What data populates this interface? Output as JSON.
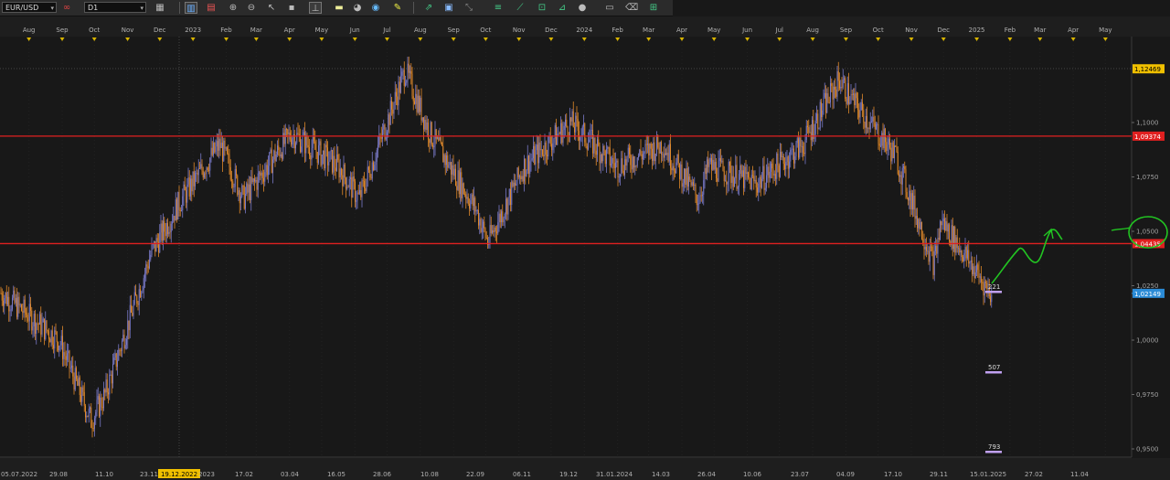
{
  "toolbar": {
    "symbol": "EUR/USD",
    "timeframe": "D1",
    "icons": [
      "chart-type-icon",
      "candles-icon",
      "bars-icon",
      "line-icon",
      "zoom-in-icon",
      "zoom-out-icon",
      "cursor-icon",
      "crosshair-icon",
      "period-separator-icon",
      "text-icon",
      "folder-icon",
      "globe-icon",
      "pencil-icon",
      "trend-icon",
      "indicator-icon",
      "fibonacci-icon",
      "ray-icon",
      "channel-icon",
      "rect-icon",
      "ellipse-icon",
      "settings-icon",
      "eraser-icon",
      "ruler-icon"
    ]
  },
  "top_axis_months": [
    "Aug",
    "Sep",
    "Oct",
    "Nov",
    "Dec",
    "2023",
    "Feb",
    "Mar",
    "Apr",
    "May",
    "Jun",
    "Jul",
    "Aug",
    "Sep",
    "Oct",
    "Nov",
    "Dec",
    "2024",
    "Feb",
    "Mar",
    "Apr",
    "May",
    "Jun",
    "Jul",
    "Aug",
    "Sep",
    "Oct",
    "Nov",
    "Dec",
    "2025",
    "Feb",
    "Mar",
    "Apr",
    "May"
  ],
  "bottom_axis_labels": [
    "05.07.2022",
    "29.08",
    "11.10",
    "23.11",
    "19.12.2022",
    "2023",
    "17.02",
    "03.04",
    "16.05",
    "28.06",
    "10.08",
    "22.09",
    "06.11",
    "19.12",
    "31.01.2024",
    "14.03",
    "26.04",
    "10.06",
    "23.07",
    "04.09",
    "17.10",
    "29.11",
    "15.01.2025",
    "27.02",
    "11.04"
  ],
  "highlighted_date": "19.12.2022",
  "price_axis_ticks": [
    "1,1000",
    "1,0750",
    "1,0500",
    "1,0250",
    "1,0000",
    "0,9750",
    "0,9500"
  ],
  "price_markers": {
    "high": {
      "label": "1,12469",
      "color": "#f0c000"
    },
    "resistance": {
      "label": "1,09374",
      "color": "#e02020"
    },
    "support": {
      "label": "1,04435",
      "color": "#e02020"
    },
    "current": {
      "label": "1,02149",
      "color": "#2b8bd6"
    }
  },
  "annotations": {
    "level_1": "221",
    "level_2": "507",
    "level_3": "793"
  },
  "colors": {
    "background": "#181818",
    "bull_candle": "#7a7ac8",
    "bear_candle": "#e0892a",
    "level_line": "#e02020",
    "projection": "#22c422",
    "annotation": "#c0a0f0"
  },
  "chart_data": {
    "type": "candlestick",
    "symbol": "EUR/USD",
    "timeframe": "D1",
    "ylim": [
      0.943,
      1.14
    ],
    "horizontal_levels": [
      1.12469,
      1.09374,
      1.04435
    ],
    "current_price": 1.02149,
    "x": [
      "2022-07-05",
      "2022-08-29",
      "2022-09-28",
      "2022-10-11",
      "2022-11-23",
      "2022-12-19",
      "2023-01-26",
      "2023-02-17",
      "2023-04-03",
      "2023-05-16",
      "2023-06-05",
      "2023-06-28",
      "2023-07-18",
      "2023-08-10",
      "2023-09-22",
      "2023-10-03",
      "2023-11-06",
      "2023-12-19",
      "2024-01-31",
      "2024-03-14",
      "2024-04-16",
      "2024-04-26",
      "2024-06-10",
      "2024-07-23",
      "2024-08-26",
      "2024-09-04",
      "2024-10-17",
      "2024-11-22",
      "2024-11-29",
      "2025-01-13",
      "2025-01-15"
    ],
    "y": [
      1.022,
      1.0,
      0.963,
      0.975,
      1.04,
      1.063,
      1.09,
      1.065,
      1.095,
      1.08,
      1.065,
      1.096,
      1.124,
      1.095,
      1.06,
      1.045,
      1.08,
      1.1,
      1.08,
      1.09,
      1.065,
      1.08,
      1.072,
      1.09,
      1.12,
      1.112,
      1.085,
      1.035,
      1.055,
      1.022,
      1.021
    ]
  }
}
